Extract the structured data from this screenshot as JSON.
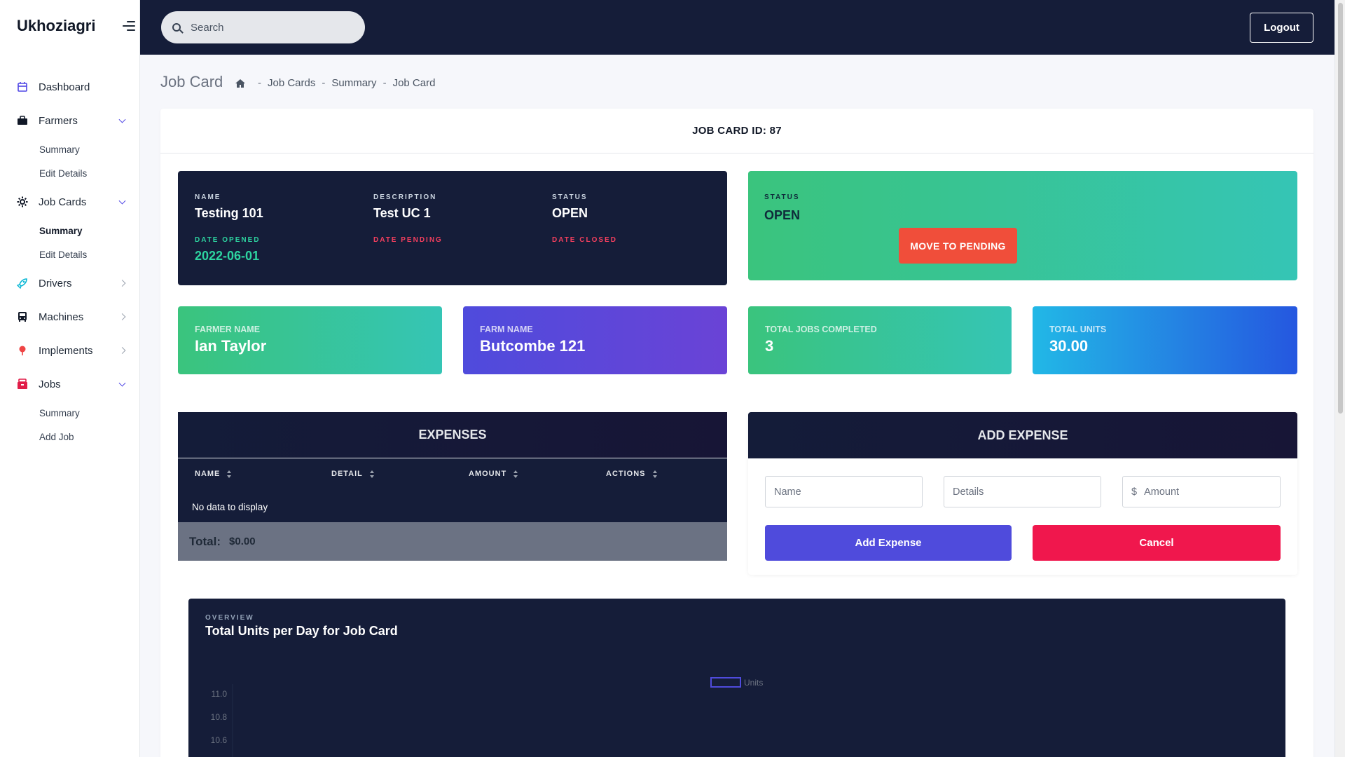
{
  "app": {
    "brand": "Ukhoziagri"
  },
  "topbar": {
    "search_placeholder": "Search",
    "logout_label": "Logout"
  },
  "sidebar": {
    "items": [
      {
        "label": "Dashboard",
        "icon": "dashboard-icon",
        "color": "#4f46e5"
      },
      {
        "label": "Farmers",
        "icon": "briefcase-icon",
        "color": "#111827",
        "expanded": true,
        "children": [
          "Summary",
          "Edit Details"
        ]
      },
      {
        "label": "Job Cards",
        "icon": "gear-icon",
        "color": "#111827",
        "expanded": true,
        "children": [
          "Summary",
          "Edit Details"
        ],
        "active_child": "Summary"
      },
      {
        "label": "Drivers",
        "icon": "rocket-icon",
        "color": "#06b6d4"
      },
      {
        "label": "Machines",
        "icon": "bus-icon",
        "color": "#111827"
      },
      {
        "label": "Implements",
        "icon": "map-pin-icon",
        "color": "#ef4444"
      },
      {
        "label": "Jobs",
        "icon": "box-icon",
        "color": "#e11d48",
        "expanded": true,
        "children": [
          "Summary",
          "Add Job"
        ]
      }
    ]
  },
  "page": {
    "title": "Job Card",
    "breadcrumb": [
      "Job Cards",
      "Summary",
      "Job Card"
    ]
  },
  "job_card": {
    "header": "JOB CARD ID: 87",
    "name_label": "NAME",
    "name": "Testing 101",
    "description_label": "DESCRIPTION",
    "description": "Test UC 1",
    "status_label": "STATUS",
    "status": "OPEN",
    "date_opened_label": "DATE OPENED",
    "date_opened": "2022-06-01",
    "date_pending_label": "DATE PENDING",
    "date_closed_label": "DATE CLOSED"
  },
  "status_panel": {
    "label": "STATUS",
    "value": "OPEN",
    "button": "MOVE TO PENDING"
  },
  "stats": [
    {
      "label": "FARMER NAME",
      "value": "Ian Taylor"
    },
    {
      "label": "FARM NAME",
      "value": "Butcombe 121"
    },
    {
      "label": "TOTAL JOBS COMPLETED",
      "value": "3"
    },
    {
      "label": "TOTAL UNITS",
      "value": "30.00"
    }
  ],
  "expenses": {
    "title": "EXPENSES",
    "columns": [
      "NAME",
      "DETAIL",
      "AMOUNT",
      "ACTIONS"
    ],
    "empty_text": "No data to display",
    "total_label": "Total:",
    "total_value": "$0.00"
  },
  "add_expense": {
    "title": "ADD EXPENSE",
    "name_placeholder": "Name",
    "details_placeholder": "Details",
    "currency": "$",
    "amount_placeholder": "Amount",
    "add_label": "Add Expense",
    "cancel_label": "Cancel"
  },
  "chart_panel": {
    "overline": "OVERVIEW",
    "title": "Total Units per Day for Job Card"
  },
  "chart_data": {
    "type": "bar",
    "series": [
      {
        "name": "Units",
        "values": []
      }
    ],
    "yticks": [
      "11.0",
      "10.8",
      "10.6"
    ],
    "legend": "top-center"
  }
}
